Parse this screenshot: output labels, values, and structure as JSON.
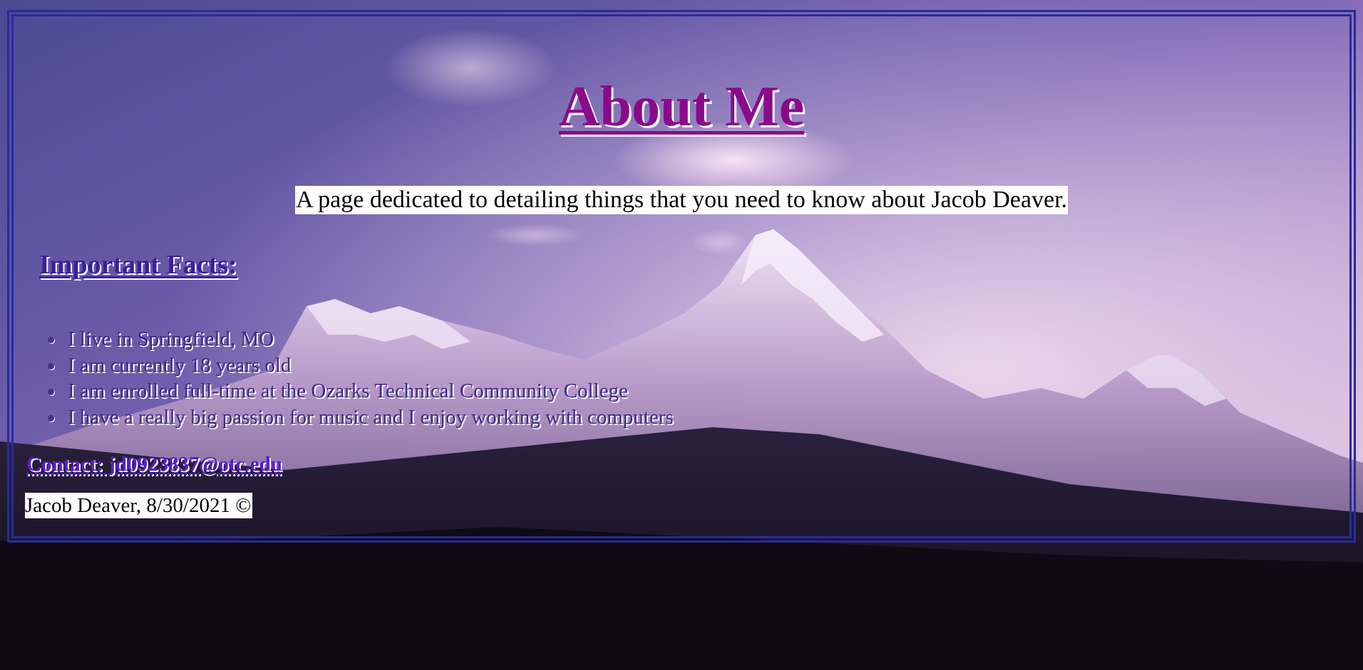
{
  "page": {
    "title": "About Me",
    "subtitle": "A page dedicated to detailing things that you need to know about Jacob Deaver."
  },
  "facts": {
    "heading": "Important Facts:",
    "items": [
      "I live in Springfield, MO",
      "I am currently 18 years old",
      "I am enrolled full-time at the Ozarks Technical Community College",
      "I have a really big passion for music and I enjoy working with computers"
    ]
  },
  "contact": {
    "label": "Contact: jd0923837@otc.edu"
  },
  "footer": {
    "text": "Jacob Deaver, 8/30/2021 ©"
  },
  "colors": {
    "frame_border": "#2a2a9c",
    "title": "#8b0a8b",
    "heading": "#3a1f9b",
    "link": "#5a1bd8",
    "sky_top": "#5a4f9a",
    "sky_glow": "#e8c6e8"
  },
  "background": {
    "icon": "mountain-landscape-image"
  }
}
